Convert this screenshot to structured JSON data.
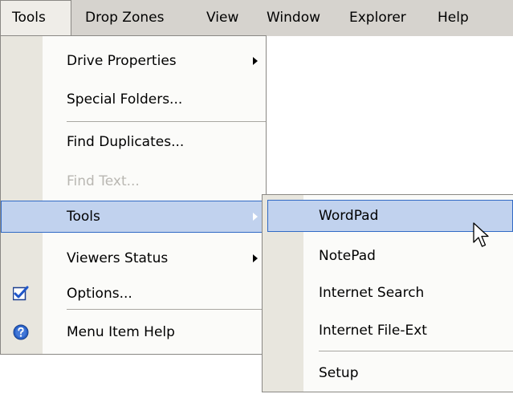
{
  "menubar": {
    "items": [
      {
        "label": "Tools",
        "active": true
      },
      {
        "label": "Drop Zones"
      },
      {
        "label": "View"
      },
      {
        "label": "Window"
      },
      {
        "label": "Explorer"
      },
      {
        "label": "Help"
      }
    ]
  },
  "tools_menu": {
    "items": [
      {
        "label": "Drive Properties",
        "submenu": true
      },
      {
        "label": "Special Folders..."
      },
      {
        "label": "Find Duplicates..."
      },
      {
        "label": "Find Text...",
        "disabled": true
      },
      {
        "label": "Tools",
        "submenu": true,
        "highlighted": true
      },
      {
        "label": "Viewers Status",
        "submenu": true
      },
      {
        "label": "Options...",
        "icon": "checkmark-icon",
        "checked": true
      },
      {
        "label": "Menu Item Help",
        "icon": "help-icon"
      }
    ]
  },
  "tools_submenu": {
    "items": [
      {
        "label": "WordPad",
        "highlighted": true
      },
      {
        "label": "NotePad"
      },
      {
        "label": "Internet Search"
      },
      {
        "label": "Internet File-Ext"
      },
      {
        "label": "Setup"
      }
    ]
  },
  "colors": {
    "menubar_bg": "#d6d3ce",
    "menu_bg": "#fbfbf9",
    "gutter_bg": "#e8e6de",
    "highlight_bg": "#c1d2ee",
    "highlight_border": "#316ac5",
    "disabled_text": "#b9b7b2"
  },
  "cursor": {
    "type": "arrow-cursor-icon"
  }
}
